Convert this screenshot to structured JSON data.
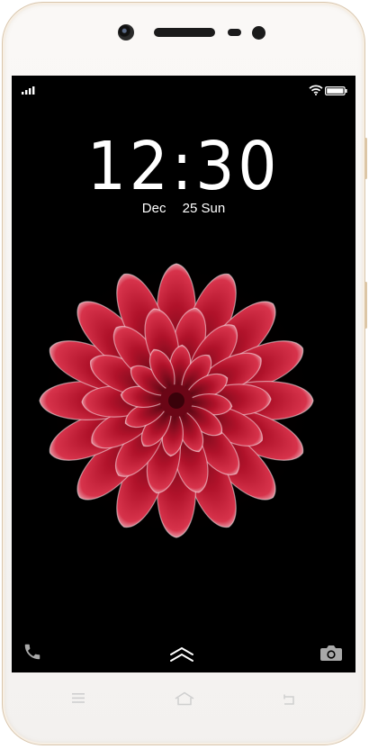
{
  "lock_screen": {
    "time": "12:30",
    "date_month": "Dec",
    "date_day": "25 Sun"
  },
  "icons": {
    "signal": "signal-icon",
    "wifi": "wifi-icon",
    "battery": "battery-icon",
    "phone": "phone-icon",
    "unlock": "chevron-up-icon",
    "camera": "camera-icon",
    "nav_menu": "menu-icon",
    "nav_home": "home-icon",
    "nav_back": "back-icon"
  },
  "colors": {
    "screen_background": "#000000",
    "flower_primary": "#b0122a",
    "flower_tips": "#f2e6ea",
    "phone_body": "#f6f3f0",
    "phone_trim": "#d9c6ad"
  }
}
